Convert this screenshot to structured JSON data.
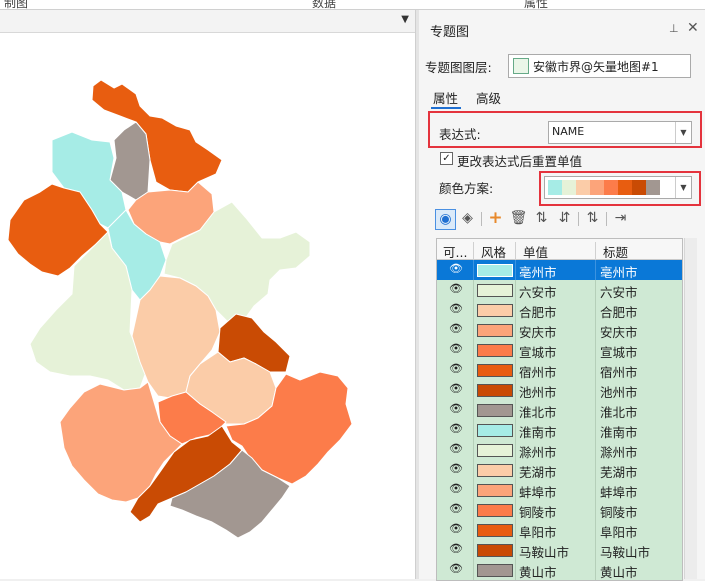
{
  "top_strip": {
    "items": [
      "制图",
      "数据",
      "属性"
    ]
  },
  "panel": {
    "title": "专题图",
    "pin_glyph": "⊥",
    "close_glyph": "✕",
    "layer_label": "专题图图层:",
    "layer_value": "安徽市界@矢量地图#1",
    "tabs": [
      {
        "label": "属性",
        "active": true
      },
      {
        "label": "高级",
        "active": false
      }
    ],
    "expression_label": "表达式:",
    "expression_value": "NAME",
    "reset_checkbox": {
      "label": "更改表达式后重置单值",
      "checked": true,
      "glyph": "✓"
    },
    "color_scheme_label": "颜色方案:",
    "color_scheme": [
      "#a6ece6",
      "#e6f2d8",
      "#fbcca8",
      "#fca47a",
      "#fc7c4a",
      "#e85d10",
      "#c94b04",
      "#a29791"
    ],
    "toolbar": {
      "icons": [
        "eye-icon",
        "style-icon",
        "add-icon",
        "delete-icon",
        "sort-asc-icon",
        "sort-desc-icon",
        "swap-icon",
        "import-icon"
      ]
    },
    "table": {
      "headers": [
        "可...",
        "风格",
        "单值",
        "标题"
      ],
      "eye_glyph": "👁",
      "rows": [
        {
          "value": "亳州市",
          "title": "亳州市",
          "color": "#a6ece6",
          "selected": true
        },
        {
          "value": "六安市",
          "title": "六安市",
          "color": "#e6f2d8",
          "selected": false
        },
        {
          "value": "合肥市",
          "title": "合肥市",
          "color": "#fbcca8",
          "selected": false
        },
        {
          "value": "安庆市",
          "title": "安庆市",
          "color": "#fca47a",
          "selected": false
        },
        {
          "value": "宣城市",
          "title": "宣城市",
          "color": "#fc7c4a",
          "selected": false
        },
        {
          "value": "宿州市",
          "title": "宿州市",
          "color": "#e85d10",
          "selected": false
        },
        {
          "value": "池州市",
          "title": "池州市",
          "color": "#c94b04",
          "selected": false
        },
        {
          "value": "淮北市",
          "title": "淮北市",
          "color": "#a29791",
          "selected": false
        },
        {
          "value": "淮南市",
          "title": "淮南市",
          "color": "#a6ece6",
          "selected": false
        },
        {
          "value": "滁州市",
          "title": "滁州市",
          "color": "#e6f2d8",
          "selected": false
        },
        {
          "value": "芜湖市",
          "title": "芜湖市",
          "color": "#fbcca8",
          "selected": false
        },
        {
          "value": "蚌埠市",
          "title": "蚌埠市",
          "color": "#fca47a",
          "selected": false
        },
        {
          "value": "铜陵市",
          "title": "铜陵市",
          "color": "#fc7c4a",
          "selected": false
        },
        {
          "value": "阜阳市",
          "title": "阜阳市",
          "color": "#e85d10",
          "selected": false
        },
        {
          "value": "马鞍山市",
          "title": "马鞍山市",
          "color": "#c94b04",
          "selected": false
        },
        {
          "value": "黄山市",
          "title": "黄山市",
          "color": "#a29791",
          "selected": false
        }
      ]
    }
  },
  "map": {
    "dropdown_glyph": "▼",
    "regions": [
      {
        "id": "suzhou",
        "color": "#e85d10"
      },
      {
        "id": "huaibei",
        "color": "#a29791"
      },
      {
        "id": "bozhou",
        "color": "#a6ece6"
      },
      {
        "id": "fuyang",
        "color": "#e85d10"
      },
      {
        "id": "bengbu",
        "color": "#fca47a"
      },
      {
        "id": "huainan",
        "color": "#a6ece6"
      },
      {
        "id": "chuzhou",
        "color": "#e6f2d8"
      },
      {
        "id": "luan",
        "color": "#e6f2d8"
      },
      {
        "id": "hefei",
        "color": "#fbcca8"
      },
      {
        "id": "maanshan",
        "color": "#c94b04"
      },
      {
        "id": "wuhu",
        "color": "#fbcca8"
      },
      {
        "id": "tongling",
        "color": "#fc7c4a"
      },
      {
        "id": "xuancheng",
        "color": "#fc7c4a"
      },
      {
        "id": "anqing",
        "color": "#fca47a"
      },
      {
        "id": "chizhou",
        "color": "#c94b04"
      },
      {
        "id": "huangshan",
        "color": "#a29791"
      }
    ]
  }
}
